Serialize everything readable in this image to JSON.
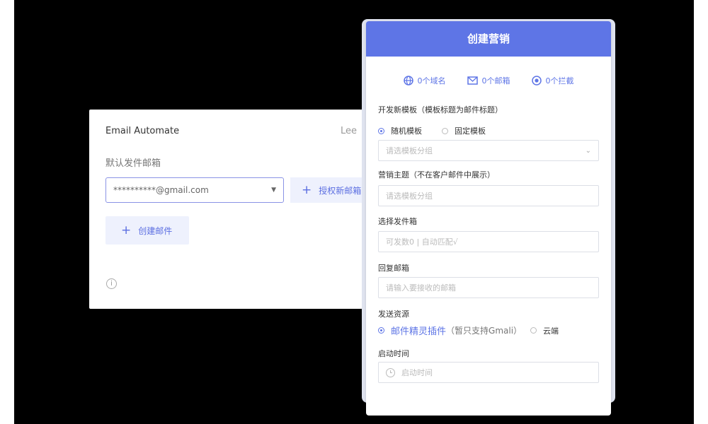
{
  "left_panel": {
    "title": "Email Automate",
    "user": "Lee",
    "sender_label": "默认发件邮箱",
    "sender_value": "**********@gmail.com",
    "authorize_button": "授权新邮箱",
    "create_mail_button": "创建邮件"
  },
  "create_panel": {
    "title": "创建营销",
    "stats": [
      {
        "icon": "globe-icon",
        "label": "0个域名"
      },
      {
        "icon": "mail-icon",
        "label": "0个邮箱"
      },
      {
        "icon": "shield-icon",
        "label": "0个拦截"
      }
    ],
    "template_label": "开发新模板（模板标题为邮件标题）",
    "template_options": [
      "随机模板",
      "固定模板"
    ],
    "template_selected": "随机模板",
    "template_select_placeholder": "请选模板分组",
    "subject_label": "营销主题（不在客户邮件中展示）",
    "subject_placeholder": "请选模板分组",
    "sender_box_label": "选择发件箱",
    "sender_box_placeholder": "可发数0 | 自动匹配√",
    "reply_label": "回复邮箱",
    "reply_placeholder": "请输入要接收的邮箱",
    "source_label": "发送资源",
    "source_plugin": "邮件精灵插件",
    "source_plugin_note": "（暂只支持Gmali）",
    "source_cloud": "云端",
    "source_selected": "邮件精灵插件",
    "start_label": "启动时间",
    "start_placeholder": "启动时间"
  },
  "colors": {
    "accent": "#5e75e6",
    "button_bg": "#eef1fd",
    "backdrop": "#000000"
  }
}
